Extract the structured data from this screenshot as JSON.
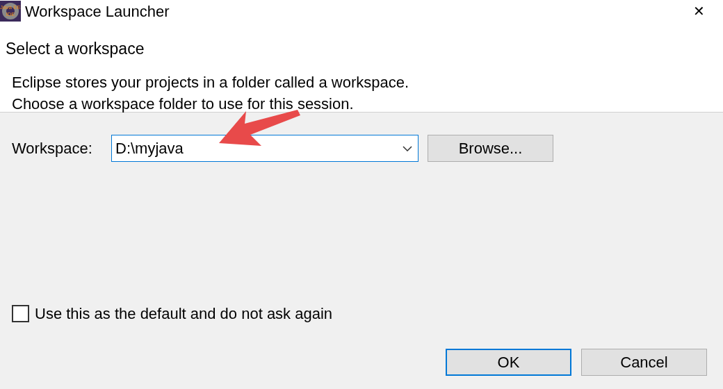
{
  "window": {
    "title": "Workspace Launcher",
    "icon_text": [
      "Java EE",
      "IDE"
    ],
    "close": "✕"
  },
  "header": {
    "title": "Select a workspace",
    "description": [
      "Eclipse stores your projects in a folder called a workspace.",
      "Choose a workspace folder to use for this session."
    ]
  },
  "workspace": {
    "label": "Workspace:",
    "value": "D:\\myjava",
    "browse": "Browse..."
  },
  "default_checkbox": {
    "label": "Use this as the default and do not ask again",
    "checked": false
  },
  "buttons": [
    {
      "label": "OK",
      "default": true
    },
    {
      "label": "Cancel",
      "default": false
    }
  ]
}
